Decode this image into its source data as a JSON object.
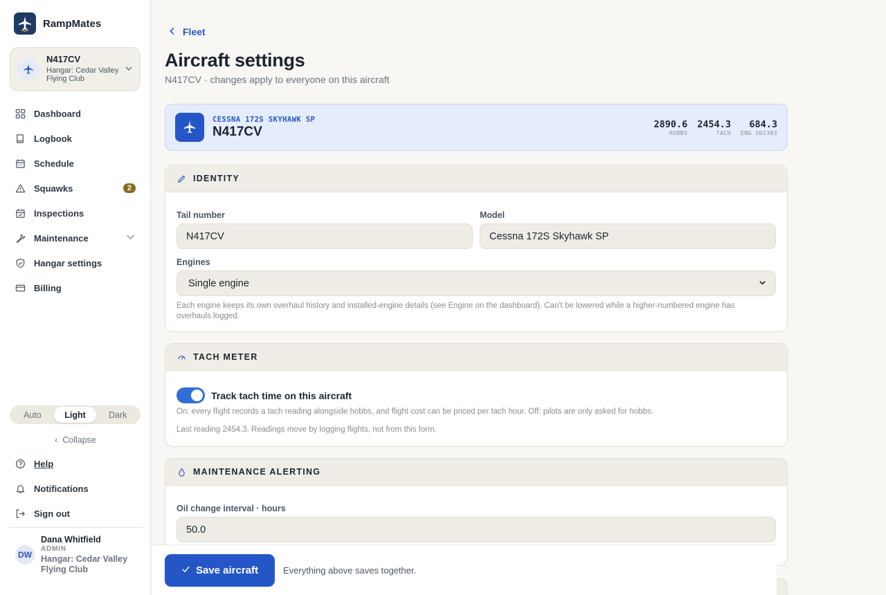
{
  "brand": {
    "name": "RampMates"
  },
  "aircraft_switcher": {
    "tail": "N417CV",
    "hangar": "Hangar: Cedar Valley Flying Club"
  },
  "nav": [
    {
      "label": "Dashboard",
      "icon": "dashboard-icon"
    },
    {
      "label": "Logbook",
      "icon": "book-icon"
    },
    {
      "label": "Schedule",
      "icon": "calendar-icon"
    },
    {
      "label": "Squawks",
      "icon": "warning-icon",
      "badge": "2"
    },
    {
      "label": "Inspections",
      "icon": "calendar-check-icon"
    },
    {
      "label": "Maintenance",
      "icon": "wrench-icon"
    },
    {
      "label": "Hangar settings",
      "icon": "shield-icon"
    },
    {
      "label": "Billing",
      "icon": "card-icon"
    }
  ],
  "theme": {
    "options": [
      "Auto",
      "Light",
      "Dark"
    ],
    "selected": "Light"
  },
  "collapse_label": "Collapse",
  "footer_nav": [
    {
      "label": "Help",
      "icon": "help-icon"
    },
    {
      "label": "Notifications",
      "icon": "bell-icon"
    },
    {
      "label": "Sign out",
      "icon": "signout-icon"
    }
  ],
  "user": {
    "name": "Dana Whitfield",
    "initials": "DW",
    "role": "ADMIN",
    "hangar": "Hangar: Cedar Valley Flying Club"
  },
  "page": {
    "back_label": "Fleet",
    "title": "Aircraft settings",
    "subtitle": "N417CV · changes apply to everyone on this aircraft"
  },
  "hero": {
    "model": "CESSNA 172S SKYHAWK SP",
    "tail": "N417CV",
    "meters": [
      {
        "value": "2890.6",
        "label": "HOBBS"
      },
      {
        "value": "2454.3",
        "label": "TACH"
      },
      {
        "value": "684.3",
        "label": "ENG 202303"
      }
    ]
  },
  "identity": {
    "title": "IDENTITY",
    "tail_label": "Tail number",
    "tail_value": "N417CV",
    "model_label": "Model",
    "model_value": "Cessna 172S Skyhawk SP",
    "engines_label": "Engines",
    "engines_value": "Single engine",
    "engines_help": "Each engine keeps its own overhaul history and installed-engine details (see Engine on the dashboard). Can't be lowered while a higher-numbered engine has overhauls logged."
  },
  "tach": {
    "title": "TACH METER",
    "toggle_label": "Track tach time on this aircraft",
    "toggle_on": true,
    "help": "On: every flight records a tach reading alongside hobbs, and flight cost can be priced per tach hour. Off: pilots are only asked for hobbs.",
    "last_reading": "Last reading 2454.3. Readings move by logging flights, not from this form."
  },
  "maintenance": {
    "title": "MAINTENANCE ALERTING",
    "oil_label": "Oil change interval · hours",
    "oil_value": "50.0"
  },
  "save": {
    "button_label": "Save aircraft",
    "note": "Everything above saves together."
  },
  "colors": {
    "accent": "#2556c7",
    "badge": "#8a6a1f",
    "hero_bg": "#e5ecfb"
  }
}
